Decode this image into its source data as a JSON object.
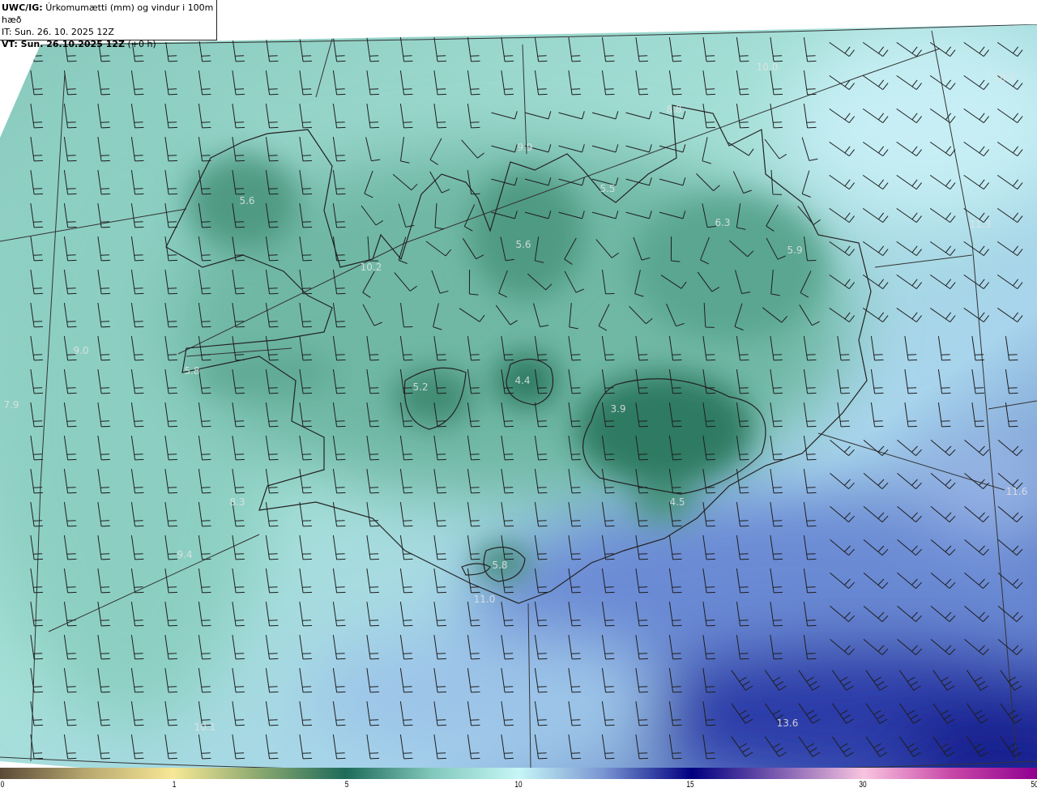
{
  "title": {
    "model": "UWC/IG:",
    "description": "Úrkomumætti (mm) og vindur i 100m hæð",
    "initial_time": "IT: Sun. 26. 10. 2025 12Z",
    "valid_time_bold": "VT: Sun. 26.10.2025 12Z",
    "valid_offset": "(+0 h)"
  },
  "map": {
    "value_labels": [
      "5.6",
      "10.2",
      "9.0",
      "5.8",
      "7.9",
      "8.3",
      "9.4",
      "5.2",
      "4.4",
      "3.9",
      "4.5",
      "5.8",
      "11.0",
      "13.6",
      "10.1",
      "10.0",
      "10.7",
      "9.9",
      "8.8",
      "5.5",
      "5.6",
      "6.3",
      "5.9",
      "11.3",
      "11.6"
    ]
  },
  "colorbar": {
    "ticks": [
      "0",
      "1",
      "5",
      "10",
      "15",
      "30",
      "50"
    ],
    "colors": [
      "#5a4a38",
      "#b8a870",
      "#f6e896",
      "#8aa870",
      "#1e6b5a",
      "#82c8bc",
      "#c6f6f6",
      "#7894d2",
      "#000080",
      "#7c5cb0",
      "#f8c4e0",
      "#c848a8",
      "#900090"
    ]
  }
}
